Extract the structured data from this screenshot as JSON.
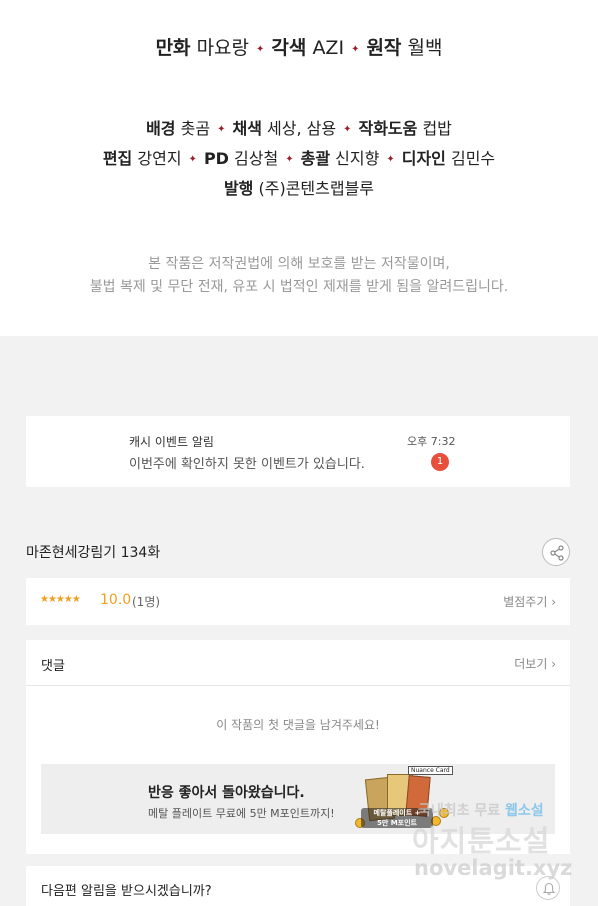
{
  "credits": {
    "line1": [
      {
        "role": "만화",
        "name": "마요랑"
      },
      {
        "role": "각색",
        "name": "AZI"
      },
      {
        "role": "원작",
        "name": "월백"
      }
    ],
    "line2": [
      {
        "role": "배경",
        "name": "촛곰"
      },
      {
        "role": "채색",
        "name": "세상, 삼용"
      },
      {
        "role": "작화도움",
        "name": "컵밥"
      }
    ],
    "line3": [
      {
        "role": "편집",
        "name": "강연지"
      },
      {
        "role": "PD",
        "name": "김상철"
      },
      {
        "role": "총괄",
        "name": "신지향"
      },
      {
        "role": "디자인",
        "name": "김민수"
      }
    ],
    "line4": [
      {
        "role": "발행",
        "name": "(주)콘텐츠랩블루"
      }
    ],
    "separator": "✦",
    "notice_line1": "본 작품은 저작권법에 의해 보호를 받는 저작물이며,",
    "notice_line2": "불법 복제 및 무단 전재, 유포 시 법적인 제재를 받게 됨을 알려드립니다."
  },
  "push_notification": {
    "title": "캐시 이벤트 알림",
    "message": "이번주에 확인하지 못한 이벤트가 있습니다.",
    "time": "오후 7:32",
    "badge": "1"
  },
  "episode": {
    "title": "마존현세강림기 134화",
    "share_icon": "share-icon"
  },
  "rating": {
    "stars": "★★★★★",
    "score": "10.0",
    "count": "(1명)",
    "rate_button": "별점주기 ›"
  },
  "comments": {
    "header": "댓글",
    "more": "더보기 ›",
    "empty": "이 작품의 첫 댓글을 남겨주세요!"
  },
  "banner": {
    "title": "반응 좋아서 돌아왔습니다.",
    "subtitle": "메탈 플레이트 무료에 5만 M포인트까지!",
    "art_label": "Nuance Card",
    "art_text_line1": "메탈플레이트 +",
    "art_text_line2": "5만 M포인트"
  },
  "next_notice": {
    "label": "다음편 알림을 받으시겠습니까?",
    "icon": "bell-icon"
  },
  "watermark": {
    "line1_a": "국내최초 무료",
    "line1_b": "웹소설",
    "line2": "아지툰소설",
    "line3": "novelagit.xyz"
  },
  "colors": {
    "accent_star": "#f0a020",
    "separator": "#9a1f2a",
    "badge": "#e84e3c",
    "background": "#f2f2f2"
  }
}
